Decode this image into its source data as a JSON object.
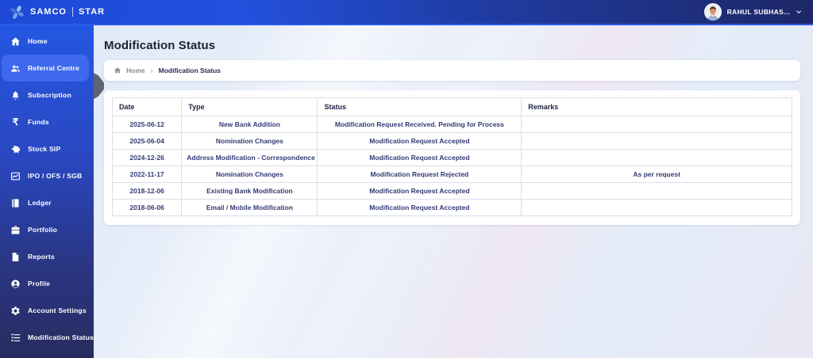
{
  "topbar": {
    "brand": {
      "name": "SAMCO",
      "product": "STAR"
    },
    "user": {
      "name": "RAHUL SUBHAS..."
    }
  },
  "sidebar": {
    "items": [
      {
        "label": "Home",
        "icon": "home-icon",
        "active": false
      },
      {
        "label": "Referral Centre",
        "icon": "users-icon",
        "active": true
      },
      {
        "label": "Subscription",
        "icon": "bell-icon",
        "active": false
      },
      {
        "label": "Funds",
        "icon": "rupee-icon",
        "active": false
      },
      {
        "label": "Stock SIP",
        "icon": "piggy-bank-icon",
        "active": false
      },
      {
        "label": "IPO / OFS / SGB",
        "icon": "chart-icon",
        "active": false
      },
      {
        "label": "Ledger",
        "icon": "book-icon",
        "active": false
      },
      {
        "label": "Portfolio",
        "icon": "briefcase-icon",
        "active": false
      },
      {
        "label": "Reports",
        "icon": "document-icon",
        "active": false
      },
      {
        "label": "Profile",
        "icon": "user-circle-icon",
        "active": false
      },
      {
        "label": "Account Settings",
        "icon": "gear-icon",
        "active": false
      },
      {
        "label": "Modification Status",
        "icon": "checklist-icon",
        "active": false
      }
    ]
  },
  "page": {
    "title": "Modification Status",
    "breadcrumb": {
      "home": "Home",
      "separator": "›",
      "current": "Modification Status"
    }
  },
  "table": {
    "headers": [
      "Date",
      "Type",
      "Status",
      "Remarks"
    ],
    "rows": [
      {
        "date": "2025-06-12",
        "type": "New Bank Addition",
        "status": "Modification Request Received. Pending for Process",
        "remarks": ""
      },
      {
        "date": "2025-06-04",
        "type": "Nomination Changes",
        "status": "Modification Request Accepted",
        "remarks": ""
      },
      {
        "date": "2024-12-26",
        "type": "Address Modification - Correspondence",
        "status": "Modification Request Accepted",
        "remarks": ""
      },
      {
        "date": "2022-11-17",
        "type": "Nomination Changes",
        "status": "Modification Request Rejected",
        "remarks": "As per request"
      },
      {
        "date": "2018-12-06",
        "type": "Existing Bank Modification",
        "status": "Modification Request Accepted",
        "remarks": ""
      },
      {
        "date": "2018-06-06",
        "type": "Email / Mobile Modification",
        "status": "Modification Request Accepted",
        "remarks": ""
      }
    ]
  },
  "colors": {
    "topbar_left": "#1d49d6",
    "topbar_right": "#1d2767",
    "sidebar_top": "#2457e2",
    "sidebar_bottom": "#272c5e",
    "active_item": "#3e69ee",
    "main_bg": "#e7eef9",
    "card_bg": "#ffffff",
    "table_border": "#d9dee8",
    "text_navy": "#333a75"
  }
}
